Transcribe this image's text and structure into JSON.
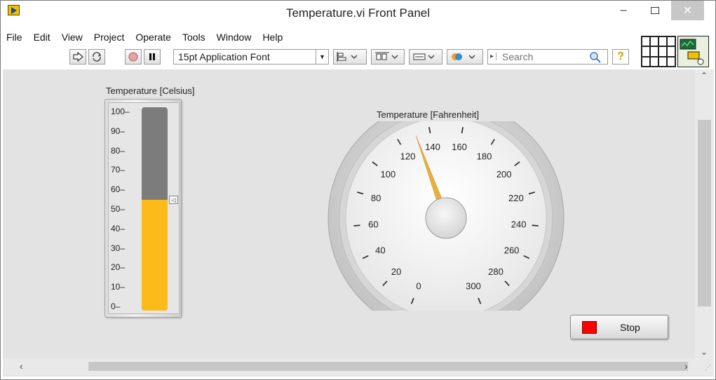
{
  "window": {
    "title": "Temperature.vi Front Panel",
    "minimize": "–",
    "close": "✕"
  },
  "menu": [
    "File",
    "Edit",
    "View",
    "Project",
    "Operate",
    "Tools",
    "Window",
    "Help"
  ],
  "toolbar": {
    "font_select": "15pt Application Font",
    "search_placeholder": "Search",
    "help_glyph": "?"
  },
  "thermometer": {
    "label": "Temperature [Celsius]",
    "scale_min": 0,
    "scale_max": 100,
    "ticks": [
      "100–",
      "90–",
      "80–",
      "70–",
      "60–",
      "50–",
      "40–",
      "30–",
      "20–",
      "10–",
      "0–"
    ],
    "value": 55,
    "fill_color": "#fcbb1b",
    "tube_color": "#7c7c7c"
  },
  "gauge": {
    "label": "Temperature [Fahrenheit]",
    "scale_min": 0,
    "scale_max": 300,
    "tick_labels": [
      "0",
      "20",
      "40",
      "60",
      "80",
      "100",
      "120",
      "140",
      "160",
      "180",
      "200",
      "220",
      "240",
      "260",
      "280",
      "300"
    ],
    "value": 131,
    "needle_color": "#e8b13a"
  },
  "stop_button": {
    "label": "Stop",
    "led_color": "#ff0000"
  }
}
